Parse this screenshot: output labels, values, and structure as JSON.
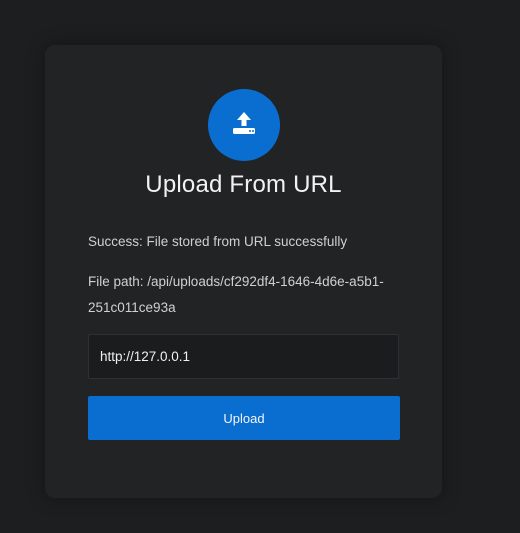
{
  "card": {
    "icon": "upload-icon",
    "title": "Upload From URL",
    "success_message": "Success: File stored from URL successfully",
    "file_path_message": "File path: /api/uploads/cf292df4-1646-4d6e-a5b1-251c011ce93a"
  },
  "form": {
    "url_value": "http://127.0.0.1",
    "upload_label": "Upload"
  },
  "colors": {
    "accent": "#0a6ed1",
    "background": "#1d1e20",
    "card": "#222325"
  }
}
